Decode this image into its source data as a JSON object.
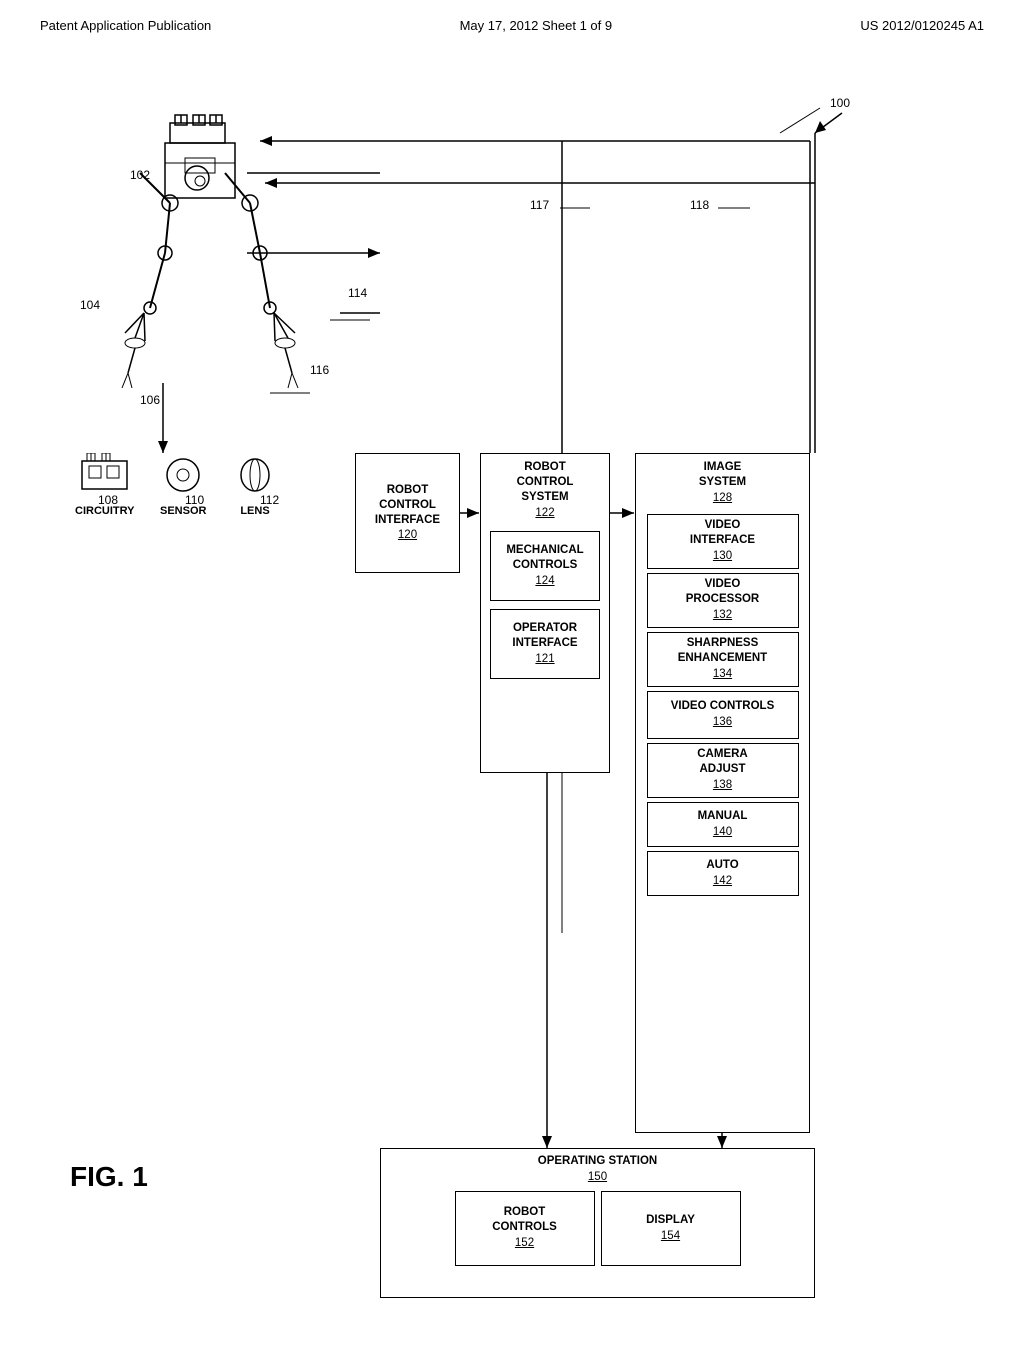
{
  "header": {
    "left": "Patent Application Publication",
    "middle": "May 17, 2012   Sheet 1 of 9",
    "right": "US 2012/0120245 A1"
  },
  "fig_label": "FIG. 1",
  "refs": {
    "r100": "100",
    "r102": "102",
    "r104": "104",
    "r106": "106",
    "r108": "108",
    "r110": "110",
    "r112": "112",
    "r114": "114",
    "r116": "116",
    "r117": "117",
    "r118": "118"
  },
  "boxes": {
    "circuitry": {
      "label": "CIRCUITRY",
      "num": "108"
    },
    "sensor": {
      "label": "SENSOR",
      "num": "110"
    },
    "lens": {
      "label": "LENS",
      "num": "112"
    },
    "robot_control_interface": {
      "label": "ROBOT\nCONTROL\nINTERFACE",
      "num": "120"
    },
    "robot_control_system": {
      "label": "ROBOT\nCONTROL\nSYSTEM",
      "num": "122"
    },
    "image_system": {
      "label": "IMAGE\nSYSTEM",
      "num": "128"
    },
    "mechanical_controls": {
      "label": "MECHANICAL\nCONTROLS",
      "num": "124"
    },
    "operator_interface": {
      "label": "OPERATOR\nINTERFACE",
      "num": "121"
    },
    "video_interface": {
      "label": "VIDEO\nINTERFACE",
      "num": "130"
    },
    "video_processor": {
      "label": "VIDEO\nPROCESSOR",
      "num": "132"
    },
    "sharpness": {
      "label": "SHARPNESS\nENHANCEMENT",
      "num": "134"
    },
    "video_controls": {
      "label": "VIDEO CONTROLS",
      "num": "136"
    },
    "camera_adjust": {
      "label": "CAMERA\nADJUST",
      "num": "138"
    },
    "manual": {
      "label": "MANUAL",
      "num": "140"
    },
    "auto": {
      "label": "AUTO",
      "num": "142"
    },
    "operating_station": {
      "label": "OPERATING STATION",
      "num": "150"
    },
    "robot_controls": {
      "label": "ROBOT\nCONTROLS",
      "num": "152"
    },
    "display": {
      "label": "DISPLAY",
      "num": "154"
    }
  }
}
